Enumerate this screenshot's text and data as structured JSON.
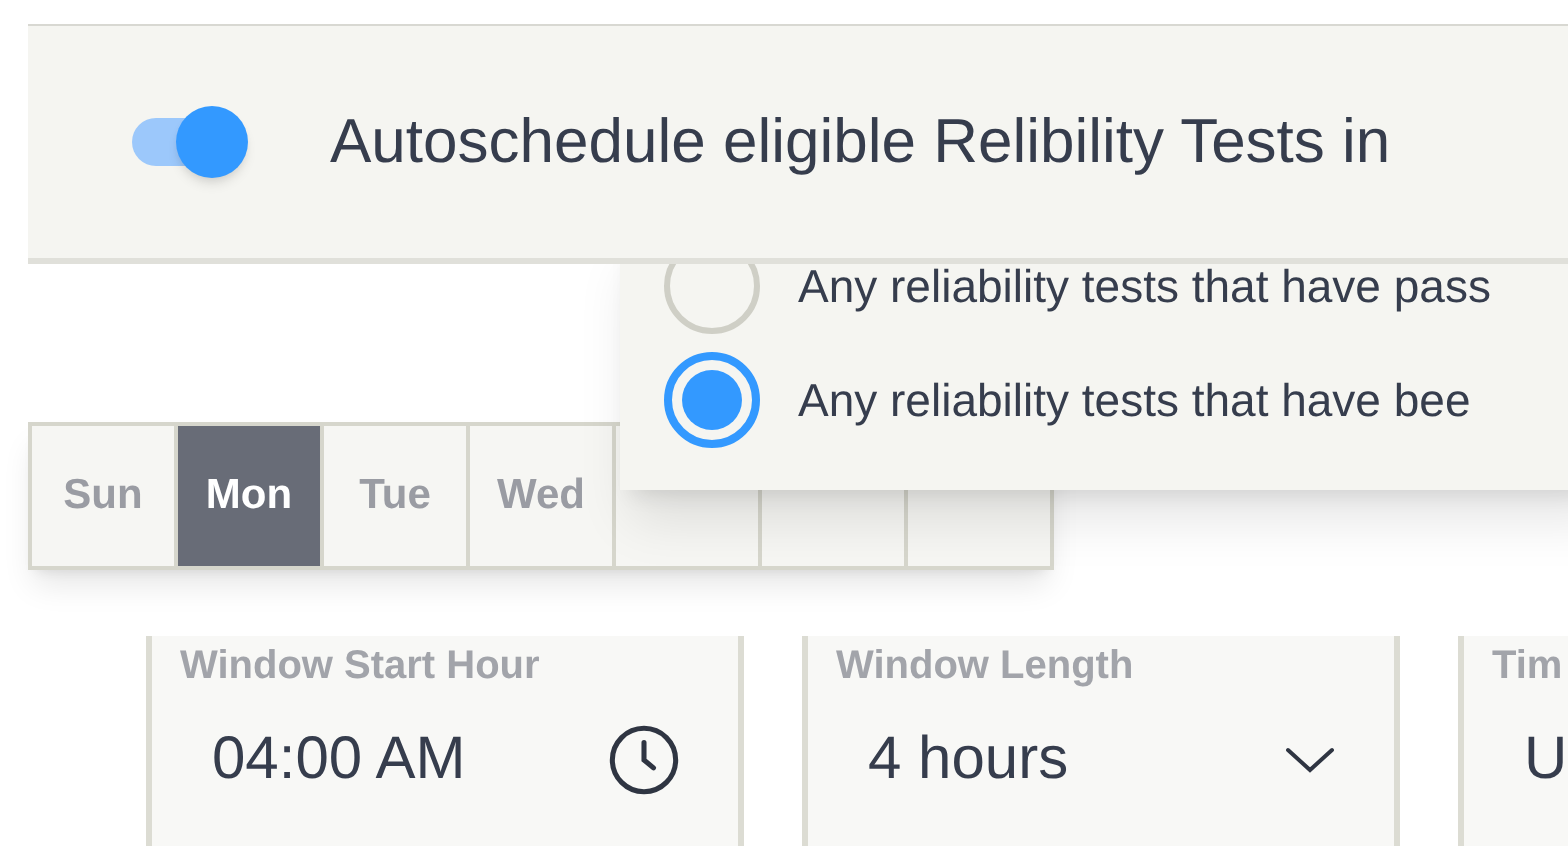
{
  "autoschedule": {
    "on": true,
    "label": "Autoschedule eligible Relibility Tests in"
  },
  "options": [
    {
      "label": "Any reliability tests that have pass",
      "selected": false
    },
    {
      "label": "Any reliability tests that have bee",
      "selected": true
    }
  ],
  "days": [
    {
      "label": "Sun",
      "selected": false
    },
    {
      "label": "Mon",
      "selected": true
    },
    {
      "label": "Tue",
      "selected": false
    },
    {
      "label": "Wed",
      "selected": false
    },
    {
      "selected": false
    },
    {
      "selected": false
    },
    {
      "selected": false
    }
  ],
  "fields": [
    {
      "kind": "time",
      "label": "Window Start Hour",
      "value": "04:00 AM"
    },
    {
      "kind": "select",
      "label": "Window Length",
      "value": "4 hours"
    },
    {
      "kind": "text",
      "label": "Tim",
      "value": "U"
    }
  ]
}
